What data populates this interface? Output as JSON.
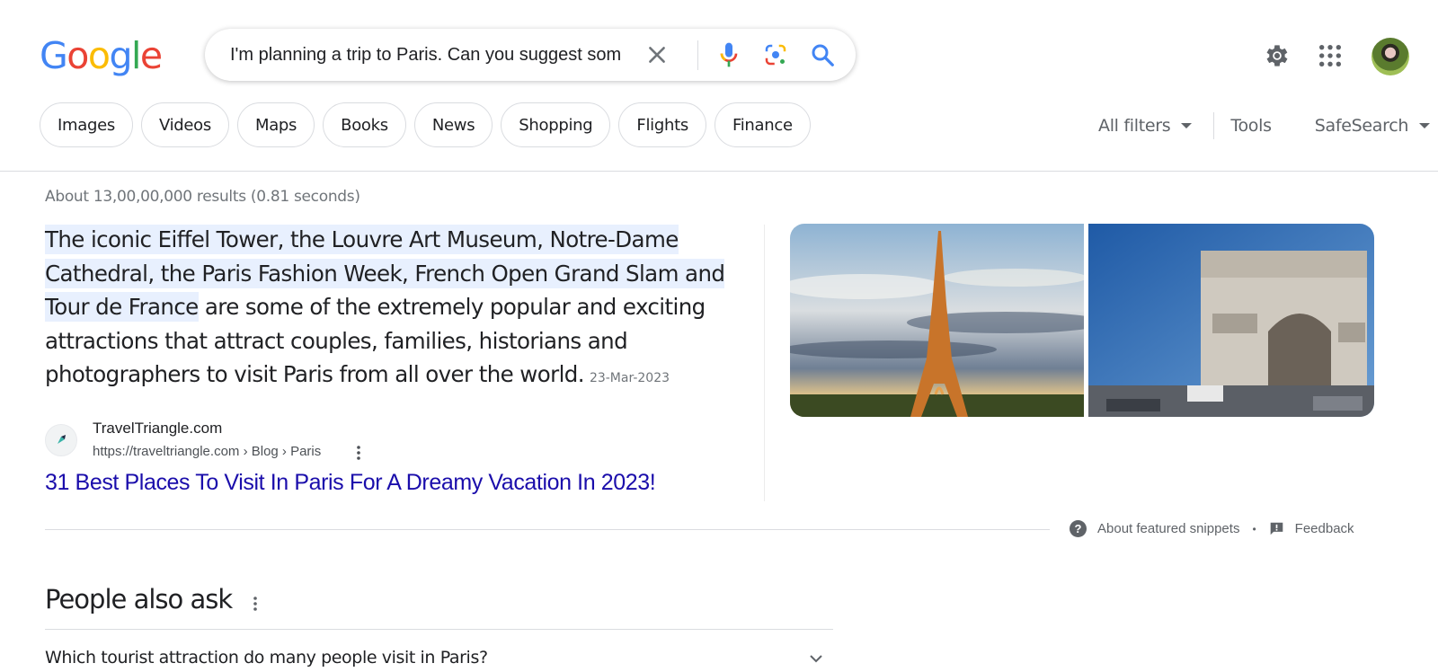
{
  "header": {
    "logo_letters": [
      {
        "char": "G",
        "color": "#4285F4"
      },
      {
        "char": "o",
        "color": "#EA4335"
      },
      {
        "char": "o",
        "color": "#FBBC05"
      },
      {
        "char": "g",
        "color": "#4285F4"
      },
      {
        "char": "l",
        "color": "#34A853"
      },
      {
        "char": "e",
        "color": "#EA4335"
      }
    ],
    "search_query": "I'm planning a trip to Paris. Can you suggest some",
    "icons": {
      "clear": "close-icon",
      "voice": "microphone-icon",
      "lens": "google-lens-icon",
      "search": "search-icon",
      "settings": "gear-icon",
      "apps": "apps-grid-icon",
      "account": "avatar"
    }
  },
  "filters": {
    "chips": [
      "Images",
      "Videos",
      "Maps",
      "Books",
      "News",
      "Shopping",
      "Flights",
      "Finance"
    ],
    "all_filters_label": "All filters",
    "tools_label": "Tools",
    "safesearch_label": "SafeSearch"
  },
  "results": {
    "stats": "About 13,00,00,000 results (0.81 seconds)",
    "featured_snippet": {
      "highlighted_text": "The iconic Eiffel Tower, the Louvre Art Museum, Notre-Dame Cathedral, the Paris Fashion Week, French Open Grand Slam and Tour de France",
      "rest_text": " are some of the extremely popular and exciting attractions that attract couples, families, historians and photographers to visit Paris from all over the world.",
      "date": "23-Mar-2023",
      "source_name": "TravelTriangle.com",
      "source_url": "https://traveltriangle.com › Blog › Paris",
      "title": "31 Best Places To Visit In Paris For A Dreamy Vacation In 2023!",
      "images": [
        {
          "subject": "Eiffel Tower at sunset"
        },
        {
          "subject": "Arc de Triomphe"
        }
      ]
    },
    "about_snippets_label": "About featured snippets",
    "separator": "•",
    "feedback_label": "Feedback"
  },
  "people_also_ask": {
    "title": "People also ask",
    "questions": [
      "Which tourist attraction do many people visit in Paris?"
    ]
  }
}
